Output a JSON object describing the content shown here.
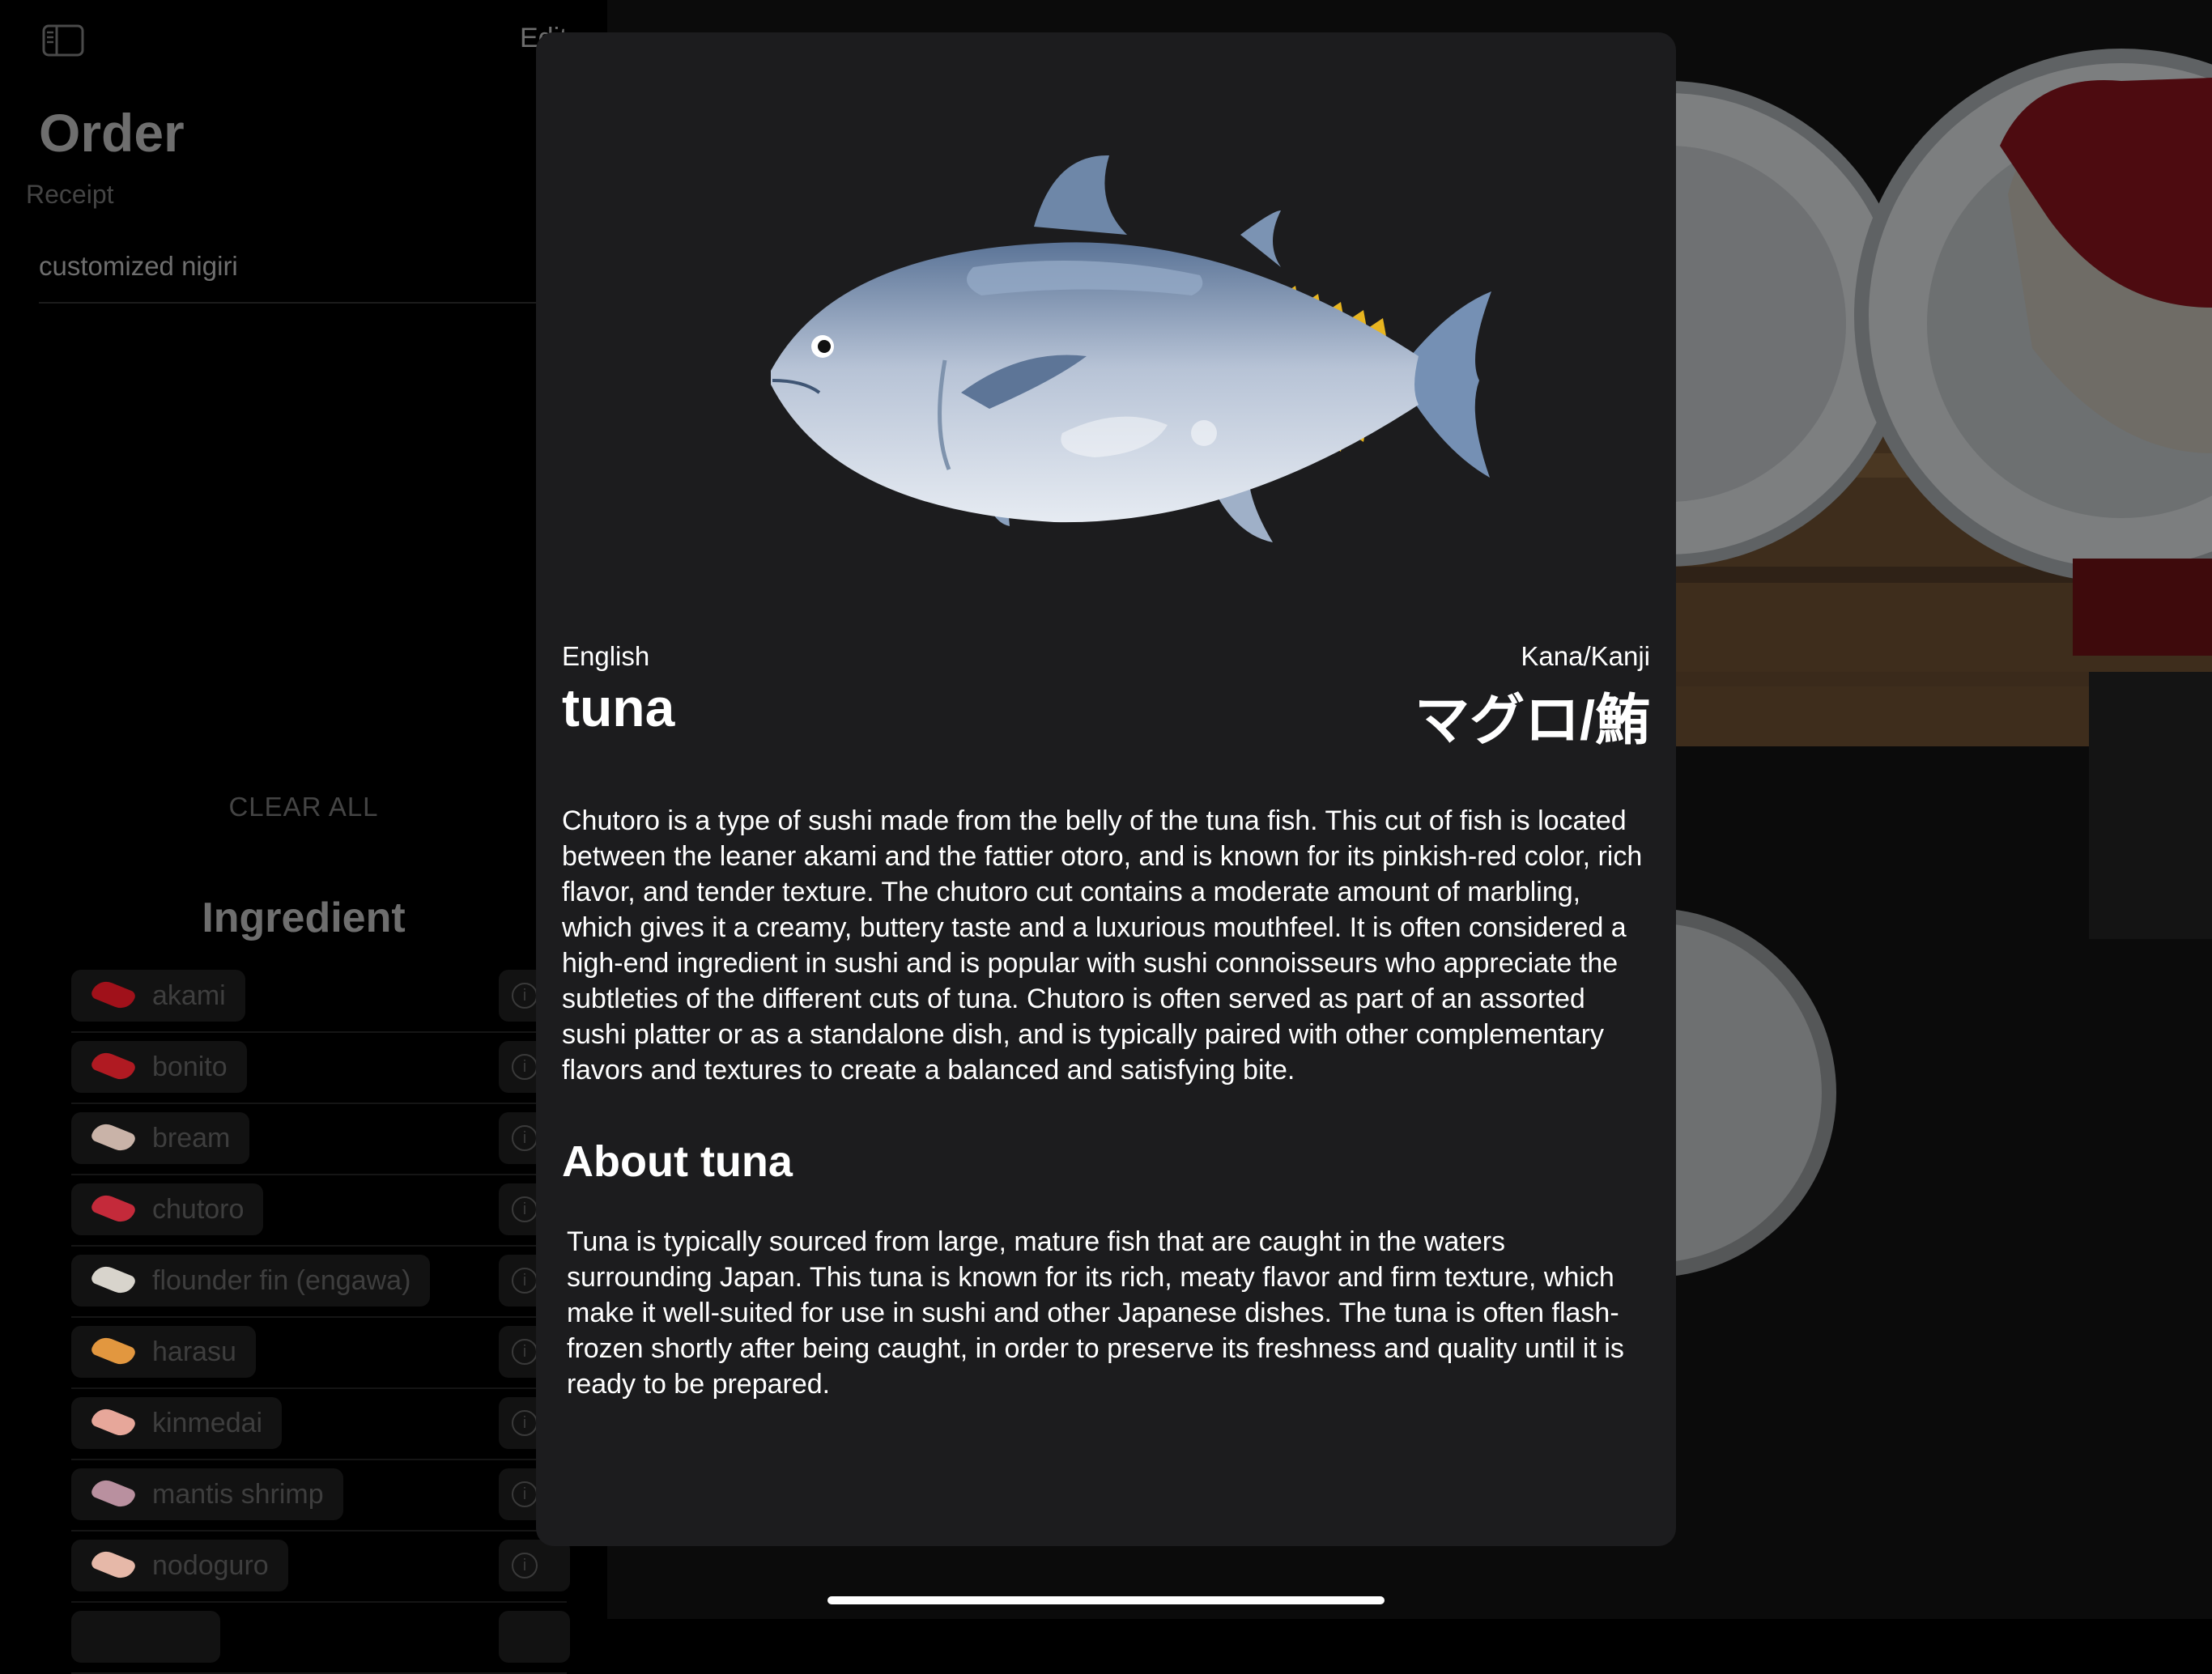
{
  "sidebar": {
    "edit_label": "Edit",
    "order_title": "Order",
    "receipt_label": "Receipt",
    "receipt_items": [
      "customized nigiri"
    ],
    "clear_all_label": "CLEAR ALL",
    "ingredient_title": "Ingredient",
    "ingredients": [
      {
        "label": "akami",
        "color": "#a0111a"
      },
      {
        "label": "bonito",
        "color": "#b01a22"
      },
      {
        "label": "bream",
        "color": "#c9b3a8"
      },
      {
        "label": "chutoro",
        "color": "#c42a3a"
      },
      {
        "label": "flounder fin (engawa)",
        "color": "#d8d4cc"
      },
      {
        "label": "harasu",
        "color": "#e2973f"
      },
      {
        "label": "kinmedai",
        "color": "#e7a79a"
      },
      {
        "label": "mantis shrimp",
        "color": "#b9909f"
      },
      {
        "label": "nodoguro",
        "color": "#e6b8a8"
      }
    ]
  },
  "modal": {
    "image_icon": "tuna-illustration",
    "english_label": "English",
    "english_value": "tuna",
    "kana_label": "Kana/Kanji",
    "kana_value": "マグロ/鮪",
    "description": "Chutoro is a type of sushi made from the belly of the tuna fish. This cut of fish is located between the leaner akami and the fattier otoro, and is known for its pinkish-red color, rich flavor, and tender texture. The chutoro cut contains a moderate amount of marbling, which gives it a creamy, buttery taste and a luxurious mouthfeel. It is often considered a high-end ingredient in sushi and is popular with sushi connoisseurs who appreciate the subtleties of the different cuts of tuna. Chutoro is often served as part of an assorted sushi platter or as a standalone dish, and is typically paired with other complementary flavors and textures to create a balanced and satisfying bite.",
    "about_title": "About tuna",
    "about_text": "Tuna is typically sourced from large, mature fish that are caught in the waters surrounding Japan. This tuna is known for its rich, meaty flavor and firm texture, which make it well-suited for use in sushi and other Japanese dishes. The tuna is often flash-frozen shortly after being caught, in order to preserve its freshness and quality until it is ready to be prepared."
  },
  "colors": {
    "modal_bg": "#1c1c1e",
    "dim_text": "#6e6e6e"
  }
}
